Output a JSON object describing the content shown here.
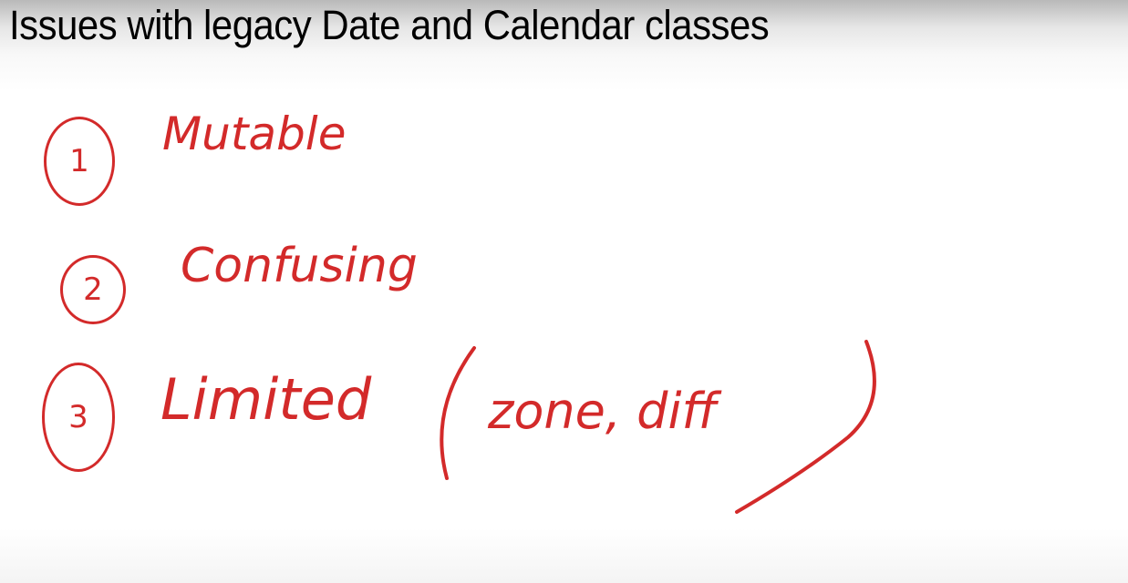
{
  "slide": {
    "title": "Issues with legacy Date and Calendar classes"
  },
  "annotations": {
    "color": "#d32a2a",
    "items": [
      {
        "number": "1",
        "text": "Mutable"
      },
      {
        "number": "2",
        "text": "Confusing"
      },
      {
        "number": "3",
        "text": "Limited",
        "detail": "zone, diff"
      }
    ]
  }
}
